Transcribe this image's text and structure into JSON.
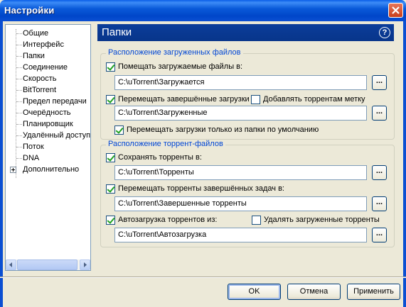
{
  "window": {
    "title": "Настройки"
  },
  "tree": {
    "items": [
      {
        "label": "Общие"
      },
      {
        "label": "Интерфейс"
      },
      {
        "label": "Папки"
      },
      {
        "label": "Соединение"
      },
      {
        "label": "Скорость"
      },
      {
        "label": "BitTorrent"
      },
      {
        "label": "Предел передачи"
      },
      {
        "label": "Очерёдность"
      },
      {
        "label": "Планировщик"
      },
      {
        "label": "Удалённый доступ"
      },
      {
        "label": "Поток"
      },
      {
        "label": "DNA"
      },
      {
        "label": "Дополнительно"
      }
    ]
  },
  "header": {
    "title": "Папки"
  },
  "downloaded": {
    "group_title": "Расположение загруженных файлов",
    "put_label": "Помещать загружаемые файлы в:",
    "put_checked": true,
    "put_path": "C:\\uTorrent\\Загружается",
    "move_label": "Перемещать завершённые загрузки",
    "move_checked": true,
    "add_label": "Добавлять торрентам метку",
    "add_checked": false,
    "move_path": "C:\\uTorrent\\Загруженные",
    "only_default_label": "Перемещать загрузки только из папки по умолчанию",
    "only_default_checked": true
  },
  "torrents": {
    "group_title": "Расположение торрент-файлов",
    "save_label": "Сохранять торренты в:",
    "save_checked": true,
    "save_path": "C:\\uTorrent\\Торренты",
    "move_done_label": "Перемещать торренты завершённых задач в:",
    "move_done_checked": true,
    "move_done_path": "C:\\uTorrent\\Завершенные торренты",
    "autoload_label": "Автозагрузка торрентов из:",
    "autoload_checked": true,
    "delete_loaded_label": "Удалять загруженные торренты",
    "delete_loaded_checked": false,
    "autoload_path": "C:\\uTorrent\\Автозагрузка"
  },
  "buttons": {
    "ok": "OK",
    "cancel": "Отмена",
    "apply": "Применить",
    "browse": "..."
  }
}
